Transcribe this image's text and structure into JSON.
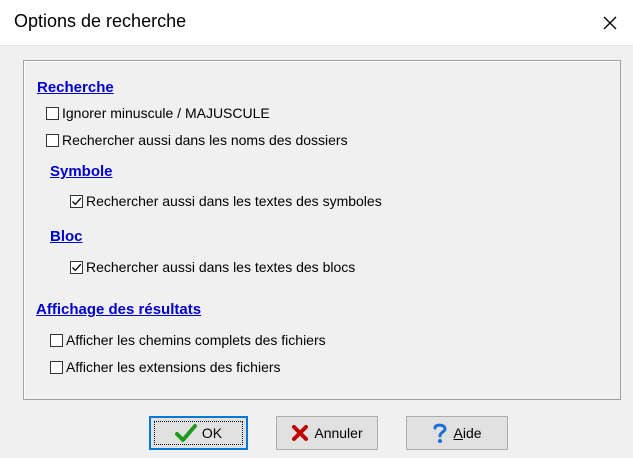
{
  "window": {
    "title": "Options de recherche"
  },
  "sections": {
    "recherche": {
      "heading": "Recherche",
      "ignore_case": {
        "label": "Ignorer minuscule / MAJUSCULE",
        "checked": false
      },
      "search_folder_names": {
        "label": "Rechercher aussi dans les noms des dossiers",
        "checked": false
      }
    },
    "symbole": {
      "heading": "Symbole",
      "search_symbol_texts": {
        "label": "Rechercher aussi dans les textes des symboles",
        "checked": true
      }
    },
    "bloc": {
      "heading": "Bloc",
      "search_block_texts": {
        "label": "Rechercher aussi dans les textes des blocs",
        "checked": true
      }
    },
    "affichage": {
      "heading": "Affichage des résultats",
      "show_full_paths": {
        "label": "Afficher les chemins complets des fichiers",
        "checked": false
      },
      "show_extensions": {
        "label": "Afficher les extensions des fichiers",
        "checked": false
      }
    }
  },
  "buttons": {
    "ok": {
      "label": "OK",
      "icon": "checkmark-icon",
      "color": "#1e9a1e"
    },
    "cancel": {
      "label": "Annuler",
      "icon": "x-icon",
      "color": "#c00000"
    },
    "help": {
      "mnemonic": "A",
      "rest": "ide",
      "icon": "question-icon",
      "color": "#1a6fd6"
    }
  }
}
